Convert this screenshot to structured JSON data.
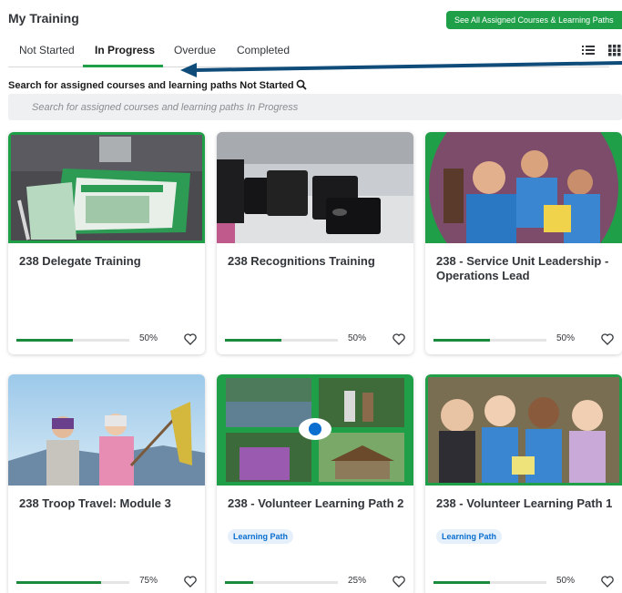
{
  "header": {
    "title": "My Training",
    "see_all_label": "See All Assigned Courses & Learning Paths"
  },
  "tabs": [
    {
      "label": "Not Started",
      "active": false
    },
    {
      "label": "In Progress",
      "active": true
    },
    {
      "label": "Overdue",
      "active": false
    },
    {
      "label": "Completed",
      "active": false
    }
  ],
  "view_icons": [
    "list-view-icon",
    "grid-view-icon"
  ],
  "search": {
    "label": "Search for assigned courses and learning paths Not Started",
    "placeholder": "Search for assigned courses and learning paths In Progress"
  },
  "colors": {
    "accent": "#1fa048",
    "progress": "#1a8a3c",
    "badge_text": "#0a6ed1",
    "annotation_arrow": "#0f4c7a"
  },
  "cards": [
    {
      "title": "238 Delegate Training",
      "badge": "",
      "progress": 50,
      "progress_label": "50%",
      "image": "annual-meeting-brochure-photo"
    },
    {
      "title": "238 Recognitions Training",
      "badge": "",
      "progress": 50,
      "progress_label": "50%",
      "image": "pin-boxes-photo"
    },
    {
      "title": "238 - Service Unit Leadership - Operations Lead",
      "badge": "",
      "progress": 50,
      "progress_label": "50%",
      "image": "scouts-circle-photo"
    },
    {
      "title": "238 Troop Travel: Module 3",
      "badge": "",
      "progress": 75,
      "progress_label": "75%",
      "image": "girls-explore-flag-photo"
    },
    {
      "title": "238 - Volunteer Learning Path 2",
      "badge": "Learning Path",
      "progress": 25,
      "progress_label": "25%",
      "image": "outdoor-collage-photo"
    },
    {
      "title": "238 - Volunteer Learning Path 1",
      "badge": "Learning Path",
      "progress": 50,
      "progress_label": "50%",
      "image": "four-girls-photo"
    }
  ]
}
